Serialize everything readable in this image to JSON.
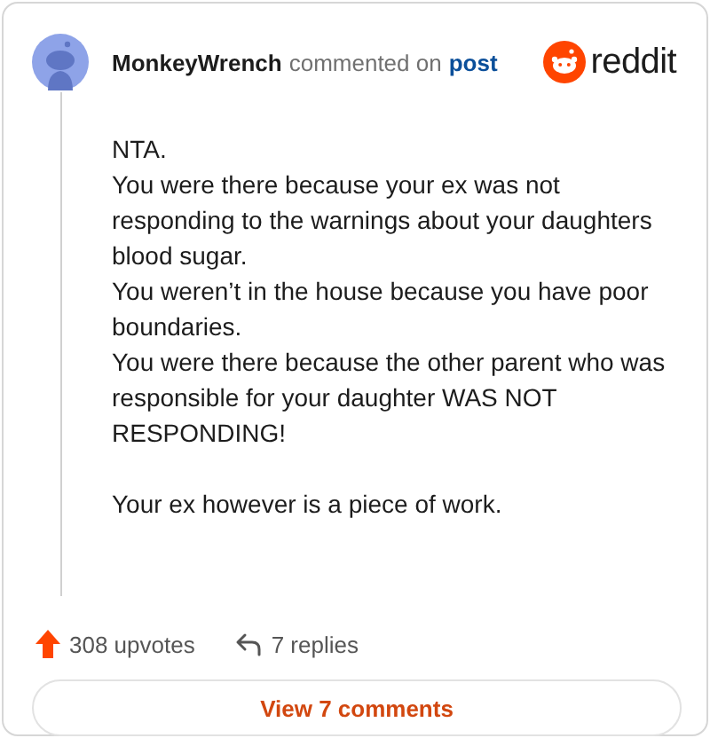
{
  "header": {
    "author": "MonkeyWrench",
    "action": "commented on",
    "link": "post",
    "brand": "reddit"
  },
  "paragraphs": [
    [
      "NTA.",
      "You were there because your ex was not responding to the warnings about your daughters blood sugar.",
      "You weren’t in the house because you have poor boundaries.",
      "You were there because the other parent who was responsible for your daughter WAS NOT RESPONDING!"
    ],
    [
      "Your ex however is a piece of work."
    ]
  ],
  "footer": {
    "upvotes": "308 upvotes",
    "replies": "7 replies"
  },
  "button": "View 7 comments"
}
